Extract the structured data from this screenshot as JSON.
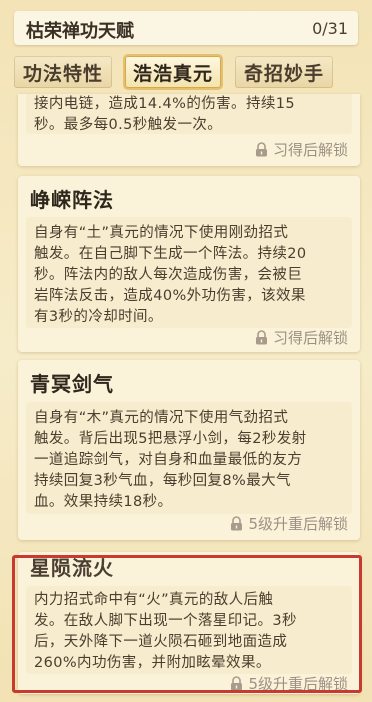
{
  "header": {
    "title": "枯荣禅功天赋",
    "counter": "0/31"
  },
  "tabs": [
    {
      "label": "功法特性",
      "active": false
    },
    {
      "label": "浩浩真元",
      "active": true
    },
    {
      "label": "奇招妙手",
      "active": false
    }
  ],
  "talents": [
    {
      "title": "",
      "desc": "接内电链，造成14.4%的伤害。持续15\n秒。最多每0.5秒触发一次。",
      "lock_text": "习得后解锁"
    },
    {
      "title": "峥嵘阵法",
      "desc": "自身有“土”真元的情况下使用刚劲招式\n触发。在自己脚下生成一个阵法。持续20\n秒。阵法内的敌人每次造成伤害，会被巨\n岩阵法反击，造成40%外功伤害，该效果\n有3秒的冷却时间。",
      "lock_text": "习得后解锁"
    },
    {
      "title": "青冥剑气",
      "desc": "自身有“木”真元的情况下使用气劲招式\n触发。背后出现5把悬浮小剑，每2秒发射\n一道追踪剑气，对自身和血量最低的友方\n持续回复3秒气血，每秒回复8%最大气\n血。效果持续18秒。",
      "lock_text": "5级升重后解锁"
    },
    {
      "title": "星陨流火",
      "desc": "内力招式命中有“火”真元的敌人后触\n发。在敌人脚下出现一个落星印记。3秒\n后，天外降下一道火陨石砸到地面造成\n260%内功伤害，并附加眩晕效果。",
      "lock_text": "5级升重后解锁"
    }
  ],
  "colors": {
    "highlight": "#c83a2e",
    "tab_active_border": "#e4c071"
  }
}
